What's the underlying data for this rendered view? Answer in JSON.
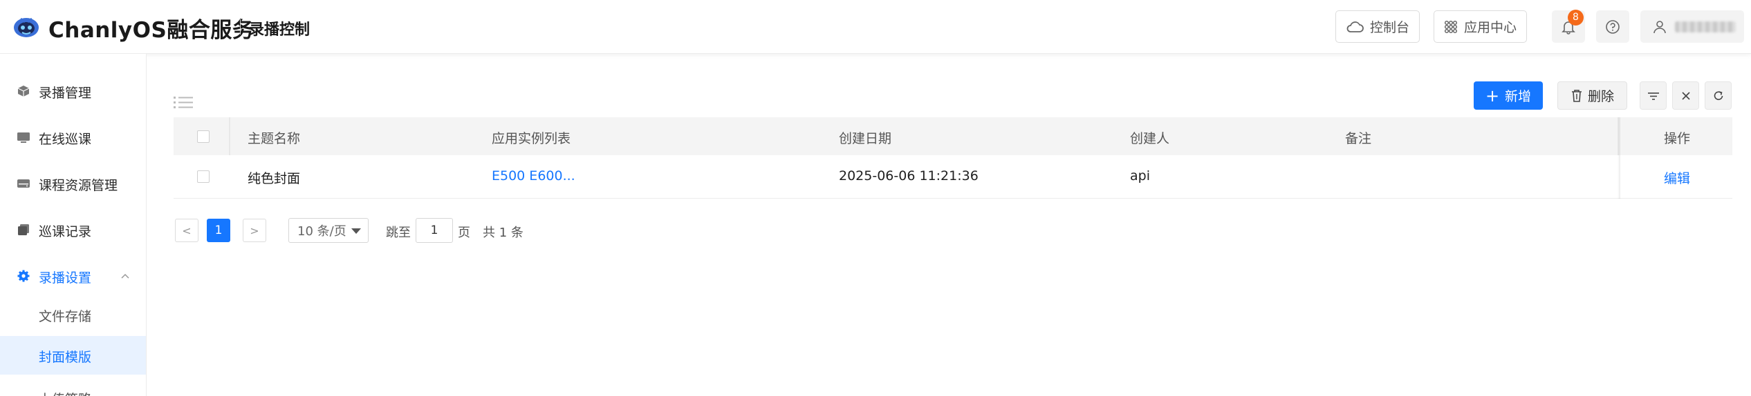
{
  "header": {
    "brand": "ChanlyOS融合服务",
    "module_title": "录播控制",
    "console_label": "控制台",
    "app_center_label": "应用中心",
    "notification_count": "8"
  },
  "sidebar": {
    "items": [
      {
        "label": "录播管理",
        "icon": "cube-icon"
      },
      {
        "label": "在线巡课",
        "icon": "monitor-icon"
      },
      {
        "label": "课程资源管理",
        "icon": "storage-icon"
      },
      {
        "label": "巡课记录",
        "icon": "copy-icon"
      },
      {
        "label": "录播设置",
        "icon": "gear-icon",
        "expanded": true
      }
    ],
    "sub_items": [
      {
        "label": "文件存储"
      },
      {
        "label": "封面模版",
        "selected": true
      },
      {
        "label": "上传策略"
      }
    ]
  },
  "toolbar": {
    "add_label": "新增",
    "delete_label": "删除"
  },
  "table": {
    "columns": [
      "主题名称",
      "应用实例列表",
      "创建日期",
      "创建人",
      "备注",
      "操作"
    ],
    "rows": [
      {
        "name": "纯色封面",
        "instances": "E500  E600...",
        "created": "2025-06-06 11:21:36",
        "creator": "api",
        "remark": "",
        "action": "编辑"
      }
    ]
  },
  "pagination": {
    "prev": "<",
    "current": "1",
    "next": ">",
    "page_size": "10 条/页",
    "jump_label": "跳至",
    "jump_value": "1",
    "page_unit": "页",
    "total": "共 1 条"
  },
  "colors": {
    "primary": "#1677ff",
    "badge": "#f56a1a",
    "header_bg": "#f4f4f4",
    "selected_bg": "#e8f2ff"
  }
}
